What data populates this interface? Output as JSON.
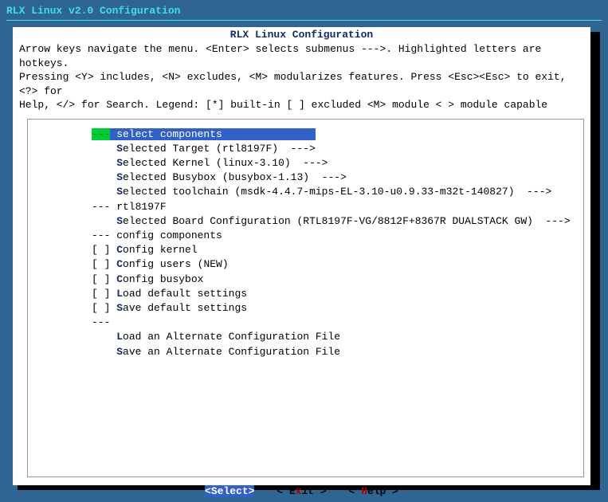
{
  "window_title": "RLX Linux v2.0 Configuration",
  "panel_title": "RLX Linux Configuration",
  "help_lines": [
    "Arrow keys navigate the menu.  <Enter> selects submenus --->.  Highlighted letters are hotkeys.",
    "Pressing <Y> includes, <N> excludes, <M> modularizes features.  Press <Esc><Esc> to exit, <?> for",
    "Help, </> for Search.  Legend: [*] built-in  [ ] excluded  <M> module  < > module capable"
  ],
  "menu": [
    {
      "prefix": "",
      "hotkey": "",
      "label": "--- select components",
      "selected": true,
      "marker": "---"
    },
    {
      "prefix": "    ",
      "hotkey": "S",
      "label": "elected Target (rtl8197F)  --->"
    },
    {
      "prefix": "    ",
      "hotkey": "S",
      "label": "elected Kernel (linux-3.10)  --->"
    },
    {
      "prefix": "    ",
      "hotkey": "S",
      "label": "elected Busybox (busybox-1.13)  --->"
    },
    {
      "prefix": "    ",
      "hotkey": "S",
      "label": "elected toolchain (msdk-4.4.7-mips-EL-3.10-u0.9.33-m32t-140827)  --->"
    },
    {
      "prefix": "--- rtl8197F",
      "hotkey": "",
      "label": ""
    },
    {
      "prefix": "    ",
      "hotkey": "S",
      "label": "elected Board Configuration (RTL8197F-VG/8812F+8367R DUALSTACK GW)  --->"
    },
    {
      "prefix": "--- config components",
      "hotkey": "",
      "label": ""
    },
    {
      "prefix": "[ ] ",
      "hotkey": "C",
      "label": "onfig kernel"
    },
    {
      "prefix": "[ ] ",
      "hotkey": "C",
      "label": "onfig users (NEW)"
    },
    {
      "prefix": "[ ] ",
      "hotkey": "C",
      "label": "onfig busybox"
    },
    {
      "prefix": "[ ] ",
      "hotkey": "L",
      "label": "oad default settings"
    },
    {
      "prefix": "[ ] ",
      "hotkey": "S",
      "label": "ave default settings"
    },
    {
      "prefix": "---",
      "hotkey": "",
      "label": ""
    },
    {
      "prefix": "    ",
      "hotkey": "L",
      "label": "oad an Alternate Configuration File"
    },
    {
      "prefix": "    ",
      "hotkey": "S",
      "label": "ave an Alternate Configuration File"
    }
  ],
  "buttons": {
    "select": {
      "pre": "<",
      "hot": "S",
      "rest": "elect>"
    },
    "exit": {
      "pre": "< E",
      "hot": "x",
      "rest": "it >"
    },
    "help": {
      "pre": "< ",
      "hot": "H",
      "rest": "elp >"
    }
  }
}
